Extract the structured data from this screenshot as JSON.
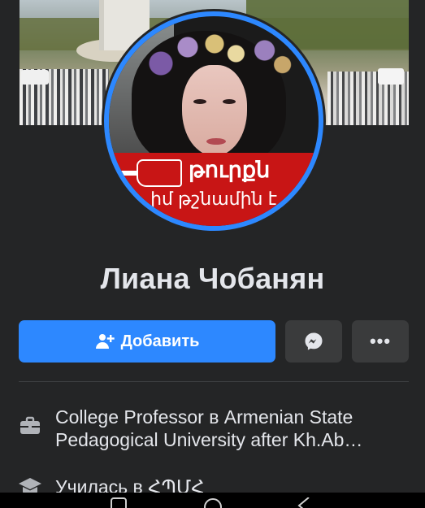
{
  "profile": {
    "name": "Лиана Чобанян",
    "banner_line1": "թուրքն",
    "banner_line2": "իմ թշնամին է"
  },
  "actions": {
    "add_friend_label": "Добавить",
    "messenger_icon": "messenger-icon",
    "more_icon": "more-icon",
    "more_label": "•••"
  },
  "info": {
    "work_line1": "College Professor в Armenian State",
    "work_line2": "Pedagogical University after Kh.Ab…",
    "education_line": "Училась в ՀՊՄՀ"
  },
  "colors": {
    "accent": "#2d88ff",
    "background": "#242526",
    "secondary_button": "#3a3b3c",
    "banner_red": "#c81515"
  }
}
